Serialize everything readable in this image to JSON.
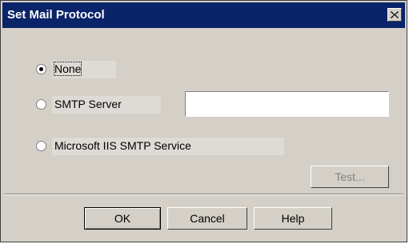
{
  "dialog": {
    "title": "Set Mail Protocol"
  },
  "options": [
    {
      "label": "None",
      "selected": true
    },
    {
      "label": "SMTP Server",
      "selected": false
    },
    {
      "label": "Microsoft IIS SMTP Service",
      "selected": false
    }
  ],
  "smtp_server": {
    "value": "",
    "placeholder": ""
  },
  "buttons": {
    "test": "Test...",
    "ok": "OK",
    "cancel": "Cancel",
    "help": "Help"
  },
  "colors": {
    "title_bar": "#0a246a",
    "dialog_face": "#d4d0c8",
    "disabled_text": "#808080"
  },
  "icons": {
    "close": "close-icon"
  }
}
